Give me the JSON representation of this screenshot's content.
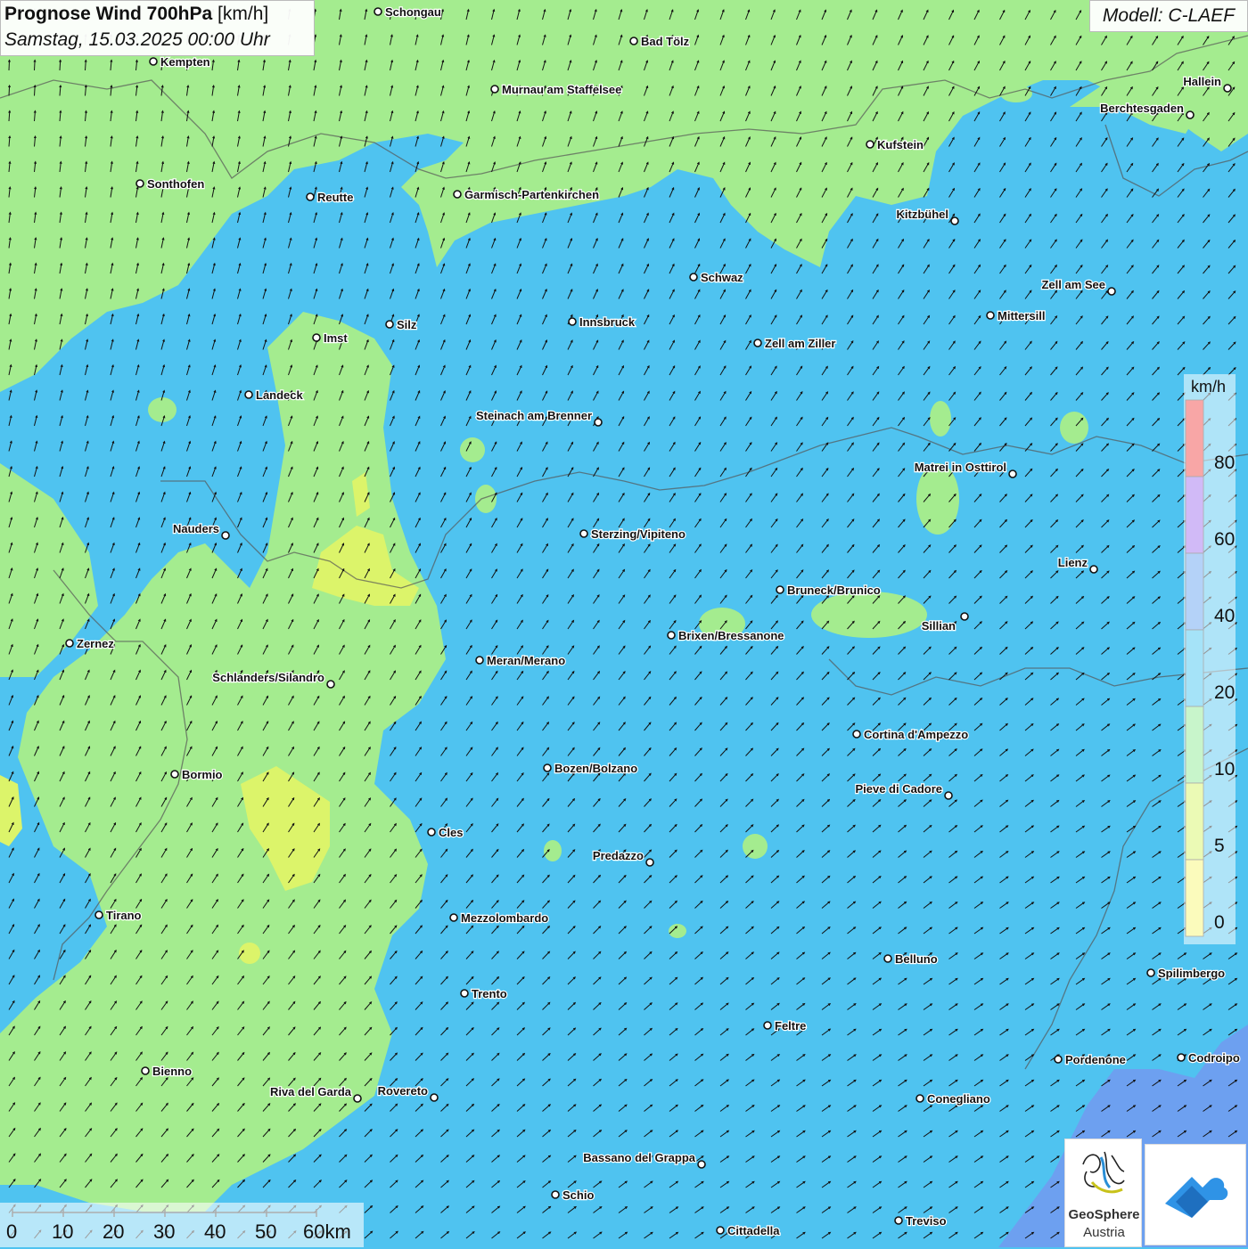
{
  "title": {
    "main": "Prognose Wind 700hPa",
    "unit": "[km/h]",
    "datetime": "Samstag, 15.03.2025 00:00 Uhr"
  },
  "model": "Modell: C-LAEF",
  "legend": {
    "unit": "km/h",
    "ticks": [
      "80",
      "60",
      "40",
      "20",
      "10",
      "5",
      "0"
    ],
    "colors": [
      "#f03a3a",
      "#9a66ee",
      "#5a9cf0",
      "#38c0f0",
      "#86e98c",
      "#d2f35c",
      "#f7f76a"
    ]
  },
  "scalebar": {
    "labels": [
      "0",
      "10",
      "20",
      "30",
      "40",
      "50",
      "60km"
    ]
  },
  "logos": {
    "geosphere_line1": "GeoSphere",
    "geosphere_line2": "Austria"
  },
  "colors": {
    "low_wind_green": "#a4ec8f",
    "mid_wind_blue": "#4fc3f0",
    "calm_yellow": "#e4f56a",
    "strong_blue": "#6da0f0"
  },
  "cities": [
    {
      "name": "Schongau"
    },
    {
      "name": "Bad Tölz"
    },
    {
      "name": "Kempten"
    },
    {
      "name": "Murnau am Staffelsee"
    },
    {
      "name": "Hallein"
    },
    {
      "name": "Berchtesgaden"
    },
    {
      "name": "Kufstein"
    },
    {
      "name": "Sonthofen"
    },
    {
      "name": "Reutte"
    },
    {
      "name": "Garmisch-Partenkirchen"
    },
    {
      "name": "Kitzbühel"
    },
    {
      "name": "Schwaz"
    },
    {
      "name": "Zell am See"
    },
    {
      "name": "Mittersill"
    },
    {
      "name": "Innsbruck"
    },
    {
      "name": "Imst"
    },
    {
      "name": "Silz"
    },
    {
      "name": "Zell am Ziller"
    },
    {
      "name": "Landeck"
    },
    {
      "name": "Steinach am Brenner"
    },
    {
      "name": "Matrei in Osttirol"
    },
    {
      "name": "Nauders"
    },
    {
      "name": "Sterzing/Vipiteno"
    },
    {
      "name": "Lienz"
    },
    {
      "name": "Bruneck/Brunico"
    },
    {
      "name": "Sillian"
    },
    {
      "name": "Brixen/Bressanone"
    },
    {
      "name": "Zernez"
    },
    {
      "name": "Meran/Merano"
    },
    {
      "name": "Schlanders/Silandro"
    },
    {
      "name": "Cortina d'Ampezzo"
    },
    {
      "name": "Bozen/Bolzano"
    },
    {
      "name": "Bormio"
    },
    {
      "name": "Pieve di Cadore"
    },
    {
      "name": "Cles"
    },
    {
      "name": "Predazzo"
    },
    {
      "name": "Tirano"
    },
    {
      "name": "Mezzolombardo"
    },
    {
      "name": "Belluno"
    },
    {
      "name": "Spilimbergo"
    },
    {
      "name": "Trento"
    },
    {
      "name": "Feltre"
    },
    {
      "name": "Bienno"
    },
    {
      "name": "Pordenone"
    },
    {
      "name": "Codroipo"
    },
    {
      "name": "Riva del Garda"
    },
    {
      "name": "Rovereto"
    },
    {
      "name": "Conegliano"
    },
    {
      "name": "Bassano del Grappa"
    },
    {
      "name": "Schio"
    },
    {
      "name": "Treviso"
    },
    {
      "name": "Cittadella"
    }
  ]
}
